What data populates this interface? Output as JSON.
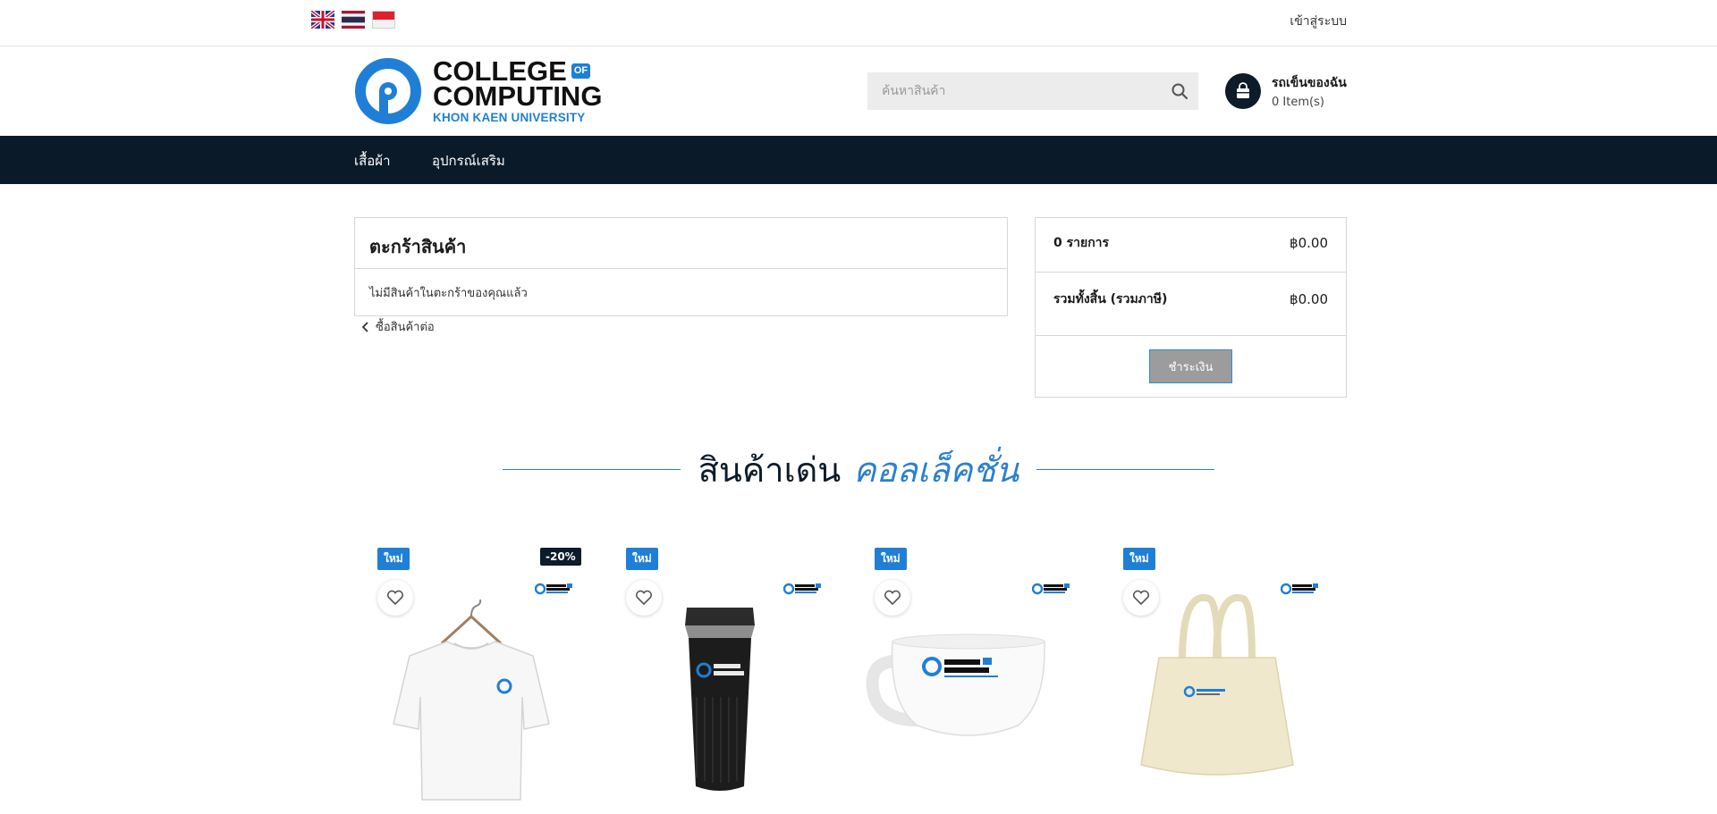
{
  "topbar": {
    "flags": [
      {
        "name": "english-flag-icon",
        "country": "United Kingdom"
      },
      {
        "name": "thai-flag-icon",
        "country": "Thailand"
      },
      {
        "name": "indonesian-flag-icon",
        "country": "Indonesia"
      }
    ],
    "login_label": "เข้าสู่ระบบ"
  },
  "header": {
    "logo": {
      "line1": "COLLEGE",
      "of": "OF",
      "line2": "COMPUTING",
      "line3": "KHON KAEN UNIVERSITY"
    },
    "search_placeholder": "ค้นหาสินค้า",
    "cart_title": "รถเข็นของฉัน",
    "cart_count": "0 Item(s)"
  },
  "nav": {
    "items": [
      {
        "label": "เสื้อผ้า"
      },
      {
        "label": "อุปกรณ์เสริม"
      }
    ]
  },
  "cart": {
    "title": "ตะกร้าสินค้า",
    "empty_message": "ไม่มีสินค้าในตะกร้าของคุณแล้ว",
    "continue_label": "ซื้อสินค้าต่อ"
  },
  "summary": {
    "items_label": "0 รายการ",
    "items_value": "฿0.00",
    "total_label": "รวมทั้งสิ้น (รวมภาษี)",
    "total_value": "฿0.00",
    "checkout_label": "ชำระเงิน"
  },
  "featured": {
    "title": "สินค้าเด่น",
    "accent": "คอลเล็คชั่น"
  },
  "products": [
    {
      "badge_new": "ใหม่",
      "badge_sale": "-20%",
      "kind": "t-shirt"
    },
    {
      "badge_new": "ใหม่",
      "badge_sale": "",
      "kind": "tumbler"
    },
    {
      "badge_new": "ใหม่",
      "badge_sale": "",
      "kind": "mug"
    },
    {
      "badge_new": "ใหม่",
      "badge_sale": "",
      "kind": "tote-bag"
    }
  ],
  "colors": {
    "navy": "#0b1a29",
    "brand_blue": "#1f7fd6",
    "checkout_gray": "#9c9c9c"
  }
}
